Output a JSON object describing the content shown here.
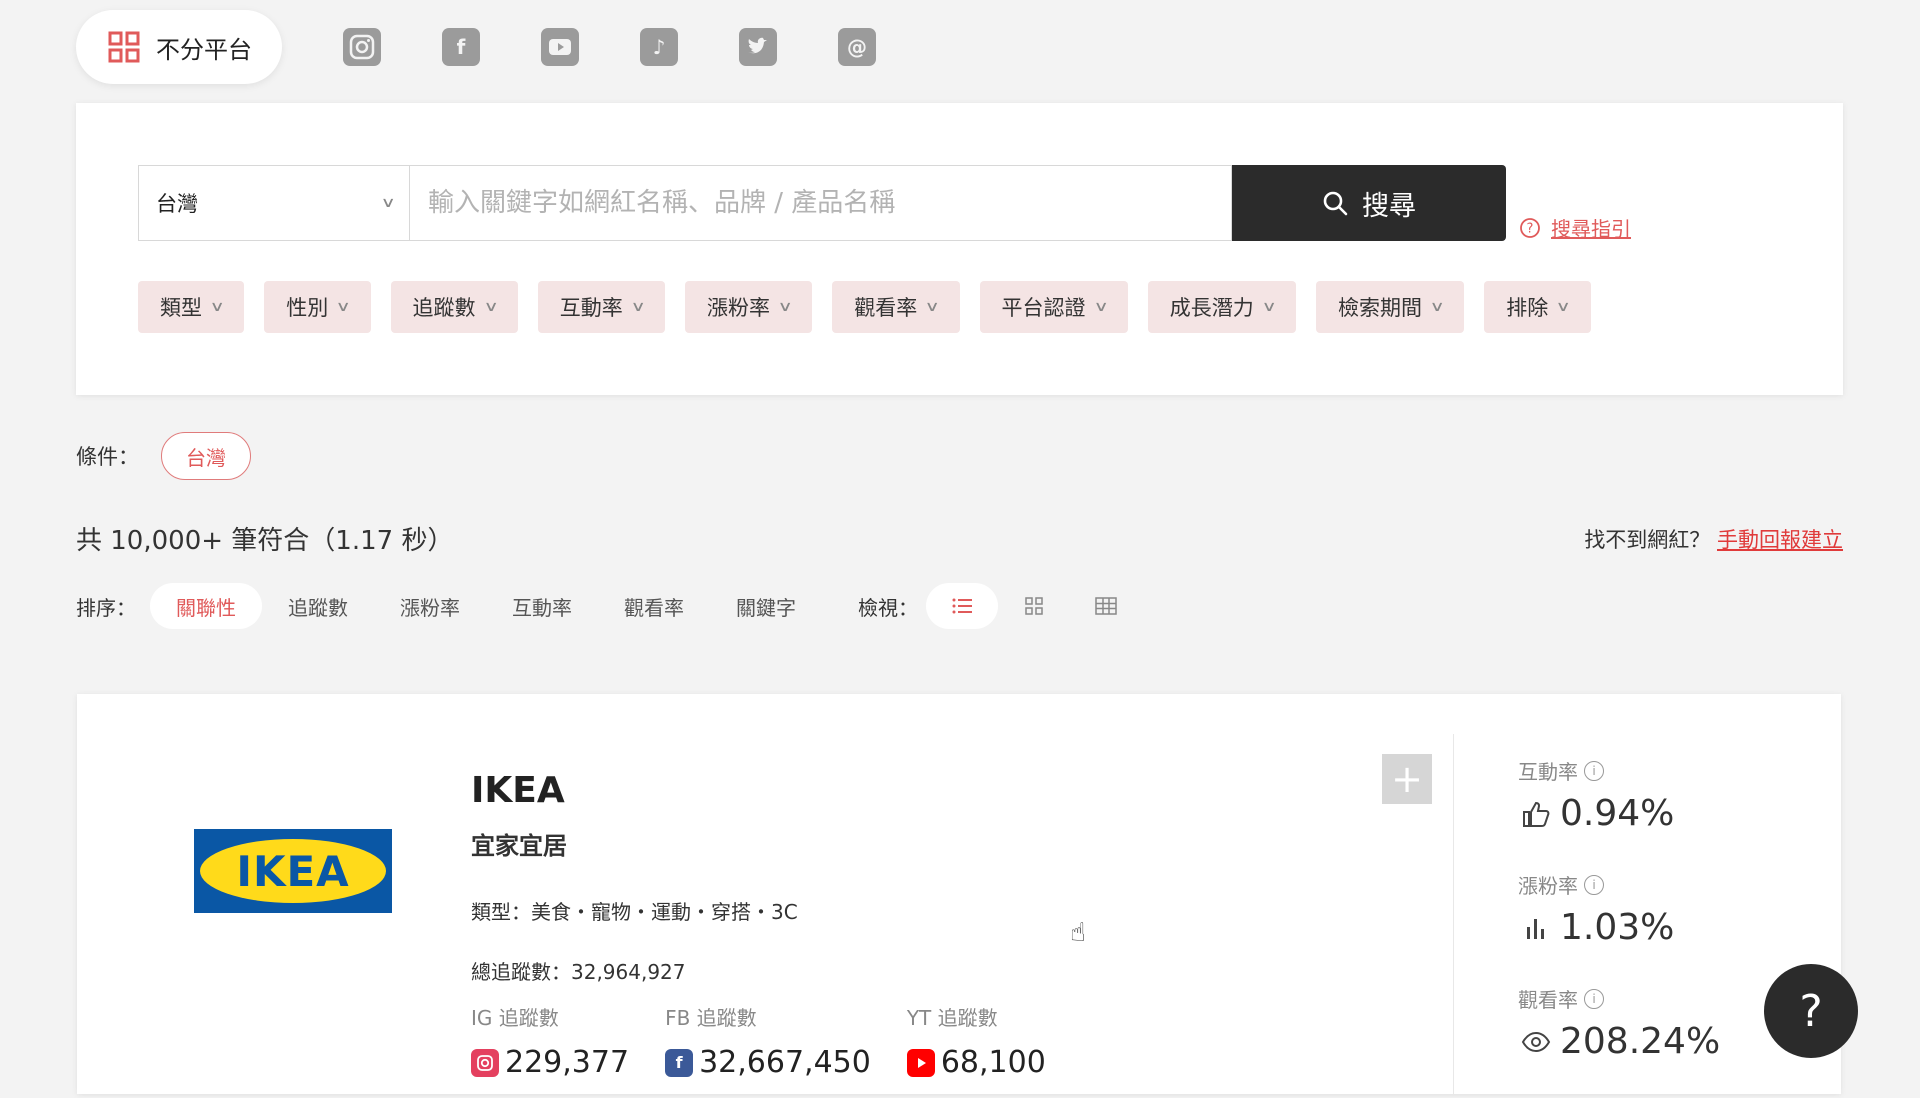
{
  "platforms": {
    "all_label": "不分平台",
    "icons": [
      "instagram-icon",
      "facebook-icon",
      "youtube-icon",
      "tiktok-icon",
      "twitter-icon",
      "threads-icon"
    ]
  },
  "search": {
    "region": "台灣",
    "placeholder": "輸入關鍵字如網紅名稱、品牌 / 產品名稱",
    "button_label": "搜尋",
    "guide_label": "搜尋指引"
  },
  "filters": [
    "類型",
    "性別",
    "追蹤數",
    "互動率",
    "漲粉率",
    "觀看率",
    "平台認證",
    "成長潛力",
    "檢索期間",
    "排除"
  ],
  "conditions": {
    "label": "條件：",
    "tags": [
      "台灣"
    ]
  },
  "results": {
    "count_text": "共 10,000+ 筆符合（1.17 秒）",
    "report_prefix": "找不到網紅？",
    "report_link": "手動回報建立"
  },
  "sort": {
    "label": "排序：",
    "items": [
      "關聯性",
      "追蹤數",
      "漲粉率",
      "互動率",
      "觀看率",
      "關鍵字"
    ],
    "active": "關聯性",
    "view_label": "檢視："
  },
  "card": {
    "logo_text": "IKEA",
    "name": "IKEA",
    "subname": "宜家宜居",
    "category": "類型：美食・寵物・運動・穿搭・3C",
    "total_followers": "總追蹤數：32,964,927",
    "platform_stats": [
      {
        "label": "IG 追蹤數",
        "value": "229,377",
        "badge": "IG",
        "color": "#e4405f"
      },
      {
        "label": "FB 追蹤數",
        "value": "32,667,450",
        "badge": "f",
        "color": "#3b5998"
      },
      {
        "label": "YT 追蹤數",
        "value": "68,100",
        "badge": "▶",
        "color": "#ff0000"
      }
    ],
    "metrics": [
      {
        "label": "互動率",
        "value": "0.94%",
        "icon": "👍"
      },
      {
        "label": "漲粉率",
        "value": "1.03%",
        "icon": "📊"
      },
      {
        "label": "觀看率",
        "value": "208.24%",
        "icon": "👁"
      }
    ]
  },
  "help": "?",
  "colors": {
    "accent": "#e05a5a",
    "dark": "#2b2b2b",
    "chip_bg": "#f4e4e4"
  }
}
